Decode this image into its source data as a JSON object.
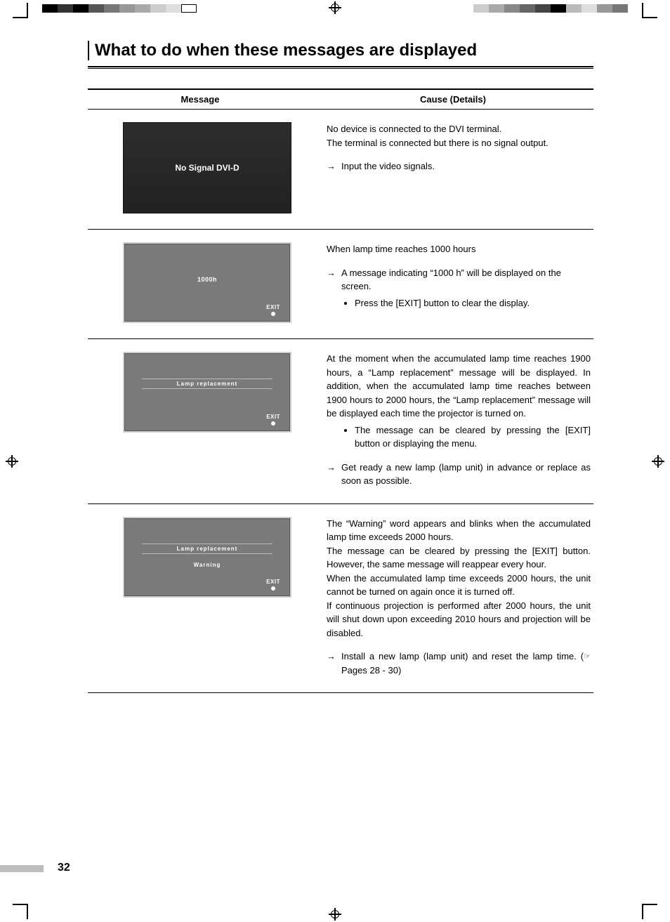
{
  "title": "What to do when these messages are displayed",
  "headers": {
    "message": "Message",
    "cause": "Cause (Details)"
  },
  "rows": [
    {
      "screen": {
        "type": "dark",
        "text": "No Signal DVI-D"
      },
      "body": {
        "p1": "No device is connected to the DVI terminal.",
        "p2": "The terminal is connected but there is no signal output.",
        "action": "Input the video signals."
      }
    },
    {
      "screen": {
        "type": "gray-center",
        "text": "1000h",
        "exit": "EXIT"
      },
      "body": {
        "p1": "When lamp time reaches 1000 hours",
        "action": "A message indicating “1000 h” will be displayed on the screen.",
        "bullet": "Press the [EXIT] button to clear the display."
      }
    },
    {
      "screen": {
        "type": "gray-bar",
        "text": "Lamp replacement",
        "exit": "EXIT"
      },
      "body": {
        "p1": "At the moment when the accumulated lamp time reaches 1900 hours, a “Lamp replacement” message will be displayed. In addition, when the accumulated lamp time reaches between 1900 hours to 2000 hours, the “Lamp replacement” message will be displayed each time the projector is turned on.",
        "bullet": "The message can be cleared by pressing the [EXIT] button or displaying the menu.",
        "action": "Get ready a new lamp (lamp unit) in advance or replace as soon as possible."
      }
    },
    {
      "screen": {
        "type": "gray-warn",
        "text": "Lamp replacement",
        "warn": "Warning",
        "exit": "EXIT"
      },
      "body": {
        "p1": "The “Warning” word appears and blinks when the accumulated lamp time exceeds 2000 hours.",
        "p2": "The message can be cleared by pressing the [EXIT] button. However, the same message will reappear every hour.",
        "p3": "When the accumulated lamp time exceeds 2000 hours, the unit cannot be turned on again once it is turned off.",
        "p4": "If continuous projection is performed after 2000 hours, the unit will shut down upon exceeding 2010 hours and projection will be disabled.",
        "action": "Install a new lamp (lamp unit) and reset the lamp time.",
        "ref": "Pages 28 - 30)"
      }
    }
  ],
  "page_number": "32",
  "icons": {
    "arrow": "→",
    "ref": "☞"
  },
  "colorbar": [
    "#000",
    "#333",
    "#000",
    "#555",
    "#777",
    "#999",
    "#aaa",
    "#ccc",
    "#ddd",
    "#fff"
  ]
}
